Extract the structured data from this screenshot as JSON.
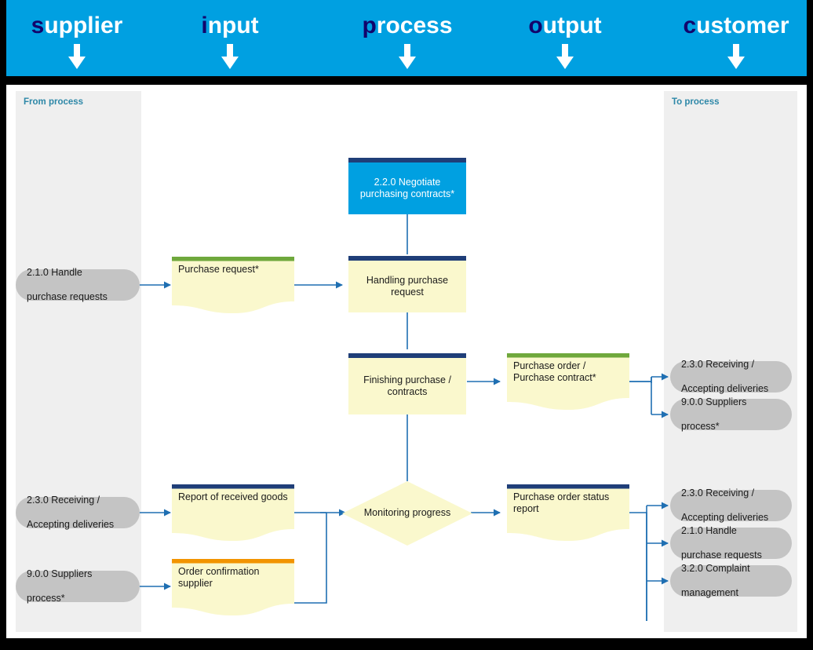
{
  "header": {
    "columns": [
      {
        "label": "supplier",
        "first": "s",
        "rest": "upplier",
        "icon": "down-arrow-icon"
      },
      {
        "label": "input",
        "first": "i",
        "rest": "nput",
        "icon": "down-arrow-icon"
      },
      {
        "label": "process",
        "first": "p",
        "rest": "rocess",
        "icon": "down-arrow-icon"
      },
      {
        "label": "output",
        "first": "o",
        "rest": "utput",
        "icon": "down-arrow-icon"
      },
      {
        "label": "customer",
        "first": "c",
        "rest": "ustomer",
        "icon": "down-arrow-icon"
      }
    ],
    "band_color": "#00A0E1",
    "first_letter_color": "#12046B",
    "text_color": "#FFFFFF"
  },
  "lanes": {
    "supplier_label": "From process",
    "customer_label": "To process",
    "label_color": "#2E88A8",
    "lane_color": "#EFEFEF"
  },
  "nodes": {
    "supplier_refs": [
      {
        "label": "2.1.0 Handle purchase requests",
        "line1": "2.1.0 Handle",
        "line2": "purchase requests"
      },
      {
        "label": "2.3.0 Receiving / Accepting deliveries",
        "line1": "2.3.0 Receiving /",
        "line2": "Accepting deliveries"
      },
      {
        "label": "9.0.0 Suppliers process*",
        "line1": "9.0.0 Suppliers",
        "line2": "process*"
      }
    ],
    "inputs": [
      {
        "label": "Purchase request*",
        "accent": "#6FA83C"
      },
      {
        "label": "Report of received goods",
        "accent": "#1F3E78"
      },
      {
        "label": "Order confirmation supplier",
        "accent": "#F29400"
      }
    ],
    "processes": [
      {
        "label": "2.2.0 Negotiate purchasing contracts*",
        "line1": "2.2.0 Negotiate",
        "line2": "purchasing contracts*",
        "style": "blue",
        "accent": "#1F3E78",
        "fill": "#00A0E1"
      },
      {
        "label": "Handling purchase request",
        "line1": "Handling purchase",
        "line2": "request",
        "style": "yellow",
        "accent": "#1F3E78",
        "fill": "#FAF8CD"
      },
      {
        "label": "Finishing purchase / contracts",
        "line1": "Finishing purchase /",
        "line2": "contracts",
        "style": "yellow",
        "accent": "#1F3E78",
        "fill": "#FAF8CD"
      },
      {
        "label": "Monitoring progress",
        "line1": "Monitoring progress",
        "line2": "",
        "style": "diamond",
        "accent": "",
        "fill": "#FAF8CD"
      }
    ],
    "outputs": [
      {
        "label": "Purchase order / Purchase contract*",
        "line1": "Purchase order / Purchase",
        "line2": "contract*",
        "accent": "#6FA83C"
      },
      {
        "label": "Purchase order status report",
        "line1": "Purchase order status report",
        "line2": "",
        "accent": "#1F3E78"
      }
    ],
    "customer_refs": [
      {
        "label": "2.3.0 Receiving / Accepting deliveries",
        "line1": "2.3.0 Receiving /",
        "line2": "Accepting deliveries"
      },
      {
        "label": "9.0.0 Suppliers process*",
        "line1": "9.0.0 Suppliers",
        "line2": "process*"
      },
      {
        "label": "2.3.0 Receiving / Accepting deliveries",
        "line1": "2.3.0 Receiving /",
        "line2": "Accepting deliveries"
      },
      {
        "label": "2.1.0 Handle purchase requests",
        "line1": "2.1.0 Handle",
        "line2": "purchase requests"
      },
      {
        "label": "3.2.0 Complaint management",
        "line1": "3.2.0 Complaint",
        "line2": "management"
      }
    ]
  },
  "colors": {
    "connector": "#1F6FB2",
    "pill_fill": "#C4C4C4",
    "doc_fill": "#FAF8CD",
    "accent_navy": "#1F3E78",
    "accent_green": "#6FA83C",
    "accent_orange": "#F29400",
    "brand_cyan": "#00A0E1"
  }
}
